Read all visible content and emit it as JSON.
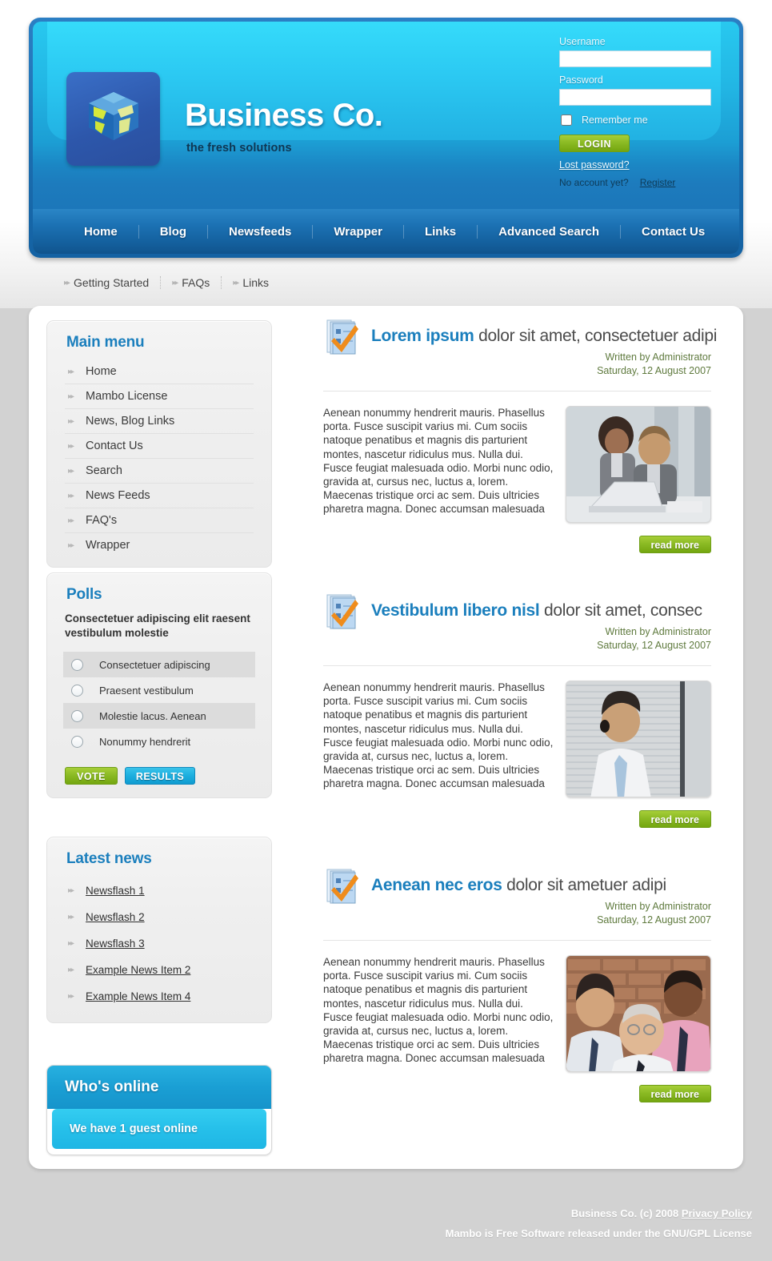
{
  "site": {
    "title": "Business Co.",
    "slogan": "the fresh solutions",
    "logo_icon": "globe-cube-icon"
  },
  "login": {
    "username_label": "Username",
    "username_value": "",
    "password_label": "Password",
    "password_value": "",
    "remember_label": "Remember me",
    "login_button": "LOGIN",
    "lost_password": "Lost password?",
    "no_account_text": "No account yet?",
    "register_link": "Register"
  },
  "nav": {
    "items": [
      {
        "label": "Home"
      },
      {
        "label": "Blog"
      },
      {
        "label": "Newsfeeds"
      },
      {
        "label": "Wrapper"
      },
      {
        "label": "Links"
      },
      {
        "label": "Advanced Search"
      },
      {
        "label": "Contact Us"
      }
    ]
  },
  "breadcrumb": {
    "items": [
      {
        "label": "Getting Started"
      },
      {
        "label": "FAQs"
      },
      {
        "label": "Links"
      }
    ]
  },
  "sidebar": {
    "main_menu": {
      "title": "Main menu",
      "items": [
        {
          "label": "Home"
        },
        {
          "label": "Mambo License"
        },
        {
          "label": "News, Blog Links"
        },
        {
          "label": "Contact Us"
        },
        {
          "label": "Search"
        },
        {
          "label": "News Feeds"
        },
        {
          "label": "FAQ's"
        },
        {
          "label": "Wrapper"
        }
      ]
    },
    "polls": {
      "title": "Polls",
      "question": "Consectetuer adipiscing elit raesent vestibulum molestie",
      "options": [
        {
          "label": "Consectetuer adipiscing"
        },
        {
          "label": "Praesent vestibulum"
        },
        {
          "label": "Molestie lacus. Aenean"
        },
        {
          "label": "Nonummy hendrerit"
        }
      ],
      "vote_button": "VOTE",
      "results_button": "RESULTS"
    },
    "latest_news": {
      "title": "Latest news",
      "items": [
        {
          "label": "Newsflash 1"
        },
        {
          "label": "Newsflash 2"
        },
        {
          "label": "Newsflash 3"
        },
        {
          "label": "Example News Item 2"
        },
        {
          "label": "Example News Item 4"
        }
      ]
    },
    "whos_online": {
      "title": "Who's online",
      "body": "We have 1 guest online"
    }
  },
  "articles": [
    {
      "title_bold": "Lorem ipsum",
      "title_rest": " dolor sit amet, consectetuer adipi",
      "author": "Written by Administrator",
      "date": "Saturday, 12 August 2007",
      "body": "Aenean nonummy hendrerit mauris. Phasellus porta. Fusce suscipit varius mi. Cum sociis natoque penatibus et magnis dis parturient montes, nascetur ridiculus mus. Nulla dui. Fusce feugiat malesuada odio. Morbi nunc odio, gravida at, cursus nec, luctus a, lorem. Maecenas tristique orci ac sem. Duis ultricies pharetra magna. Donec accumsan malesuada",
      "read_more": "read more",
      "photo_alt": "two-colleagues-at-laptop-photo"
    },
    {
      "title_bold": "Vestibulum libero nisl",
      "title_rest": " dolor sit amet, consec",
      "author": "Written by Administrator",
      "date": "Saturday, 12 August 2007",
      "body": "Aenean nonummy hendrerit mauris. Phasellus porta. Fusce suscipit varius mi. Cum sociis natoque penatibus et magnis dis parturient montes, nascetur ridiculus mus. Nulla dui. Fusce feugiat malesuada odio. Morbi nunc odio, gravida at, cursus nec, luctus a, lorem. Maecenas tristique orci ac sem. Duis ultricies pharetra magna. Donec accumsan malesuada",
      "read_more": "read more",
      "photo_alt": "man-on-phone-photo"
    },
    {
      "title_bold": "Aenean nec eros",
      "title_rest": " dolor sit ametuer adipi",
      "author": "Written by Administrator",
      "date": "Saturday, 12 August 2007",
      "body": "Aenean nonummy hendrerit mauris. Phasellus porta. Fusce suscipit varius mi. Cum sociis natoque penatibus et magnis dis parturient montes, nascetur ridiculus mus. Nulla dui. Fusce feugiat malesuada odio. Morbi nunc odio, gravida at, cursus nec, luctus a, lorem. Maecenas tristique orci ac sem. Duis ultricies pharetra magna. Donec accumsan malesuada",
      "read_more": "read more",
      "photo_alt": "three-men-smiling-photo"
    }
  ],
  "footer": {
    "line1_text": "Business Co. (c) 2008 ",
    "privacy_link": "Privacy Policy",
    "line2": "Mambo is Free Software released under the GNU/GPL License"
  },
  "colors": {
    "accent_blue": "#1b7fbd",
    "header_cyan": "#28c8ef",
    "nav_blue": "#1c72b4",
    "green_button": "#8bbb24",
    "meta_green": "#5f7a3e",
    "page_bg": "#d2d2d2"
  }
}
